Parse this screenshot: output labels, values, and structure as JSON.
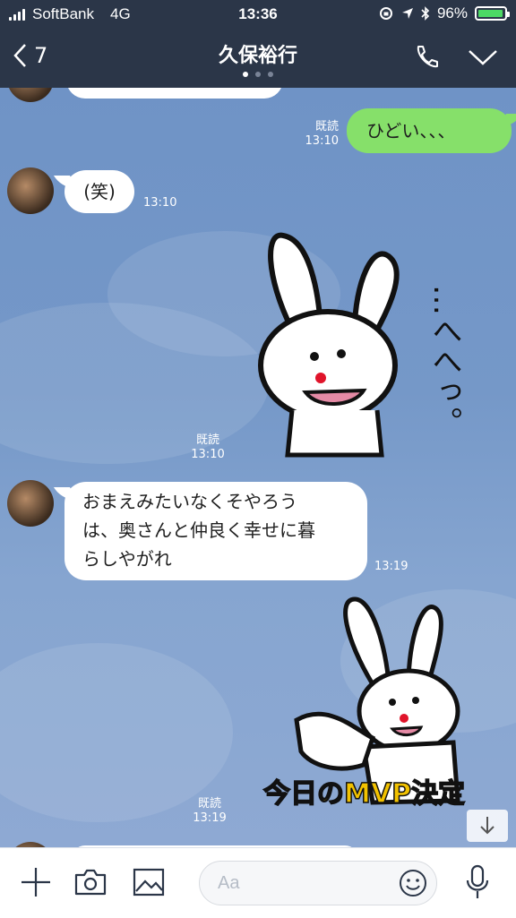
{
  "status": {
    "carrier": "SoftBank",
    "network": "4G",
    "time": "13:36",
    "battery": "96%",
    "battery_level": 0.96
  },
  "header": {
    "back_count": "7",
    "title": "久保裕行"
  },
  "messages": [
    {
      "read": "既読",
      "time": "13:10",
      "text": "ひどい、、、"
    },
    {
      "time": "13:10",
      "text": "(笑)"
    },
    {
      "read": "既読",
      "time": "13:10"
    },
    {
      "time": "13:19",
      "lines": [
        "おまえみたいなくそやろう",
        "は、奥さんと仲良く幸せに暮",
        "らしやがれ"
      ]
    },
    {
      "read": "既読",
      "time": "13:19"
    }
  ],
  "sticker1": {
    "text": "…へへっ。"
  },
  "sticker2": {
    "text": "今日のMVP決定"
  },
  "composer": {
    "placeholder": "Aa"
  }
}
